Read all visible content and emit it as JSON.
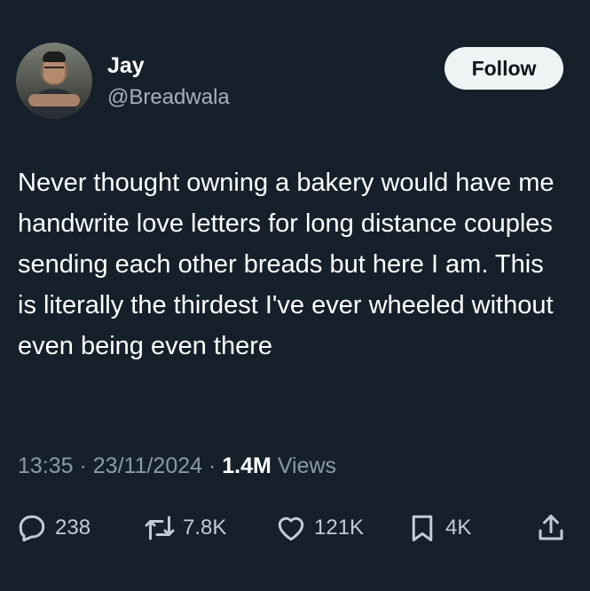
{
  "author": {
    "name": "Jay",
    "handle": "@Breadwala"
  },
  "follow_label": "Follow",
  "tweet": {
    "text": "Never thought owning a bakery would have me handwrite love letters for long distance couples sending each other breads but here I am. This is literally the thirdest I've ever wheeled without even being even there"
  },
  "meta": {
    "time": "13:35",
    "sep1": " · ",
    "date": "23/11/2024",
    "sep2": " · ",
    "views_count": "1.4M",
    "views_label": " Views"
  },
  "actions": {
    "replies": "238",
    "reposts": "7.8K",
    "likes": "121K",
    "bookmarks": "4K"
  },
  "icons": [
    "reply-icon",
    "repost-icon",
    "like-icon",
    "bookmark-icon",
    "share-icon"
  ],
  "colors": {
    "background": "#15202b",
    "secondary_text": "#8b98a5",
    "follow_button": "#eff3f4"
  }
}
